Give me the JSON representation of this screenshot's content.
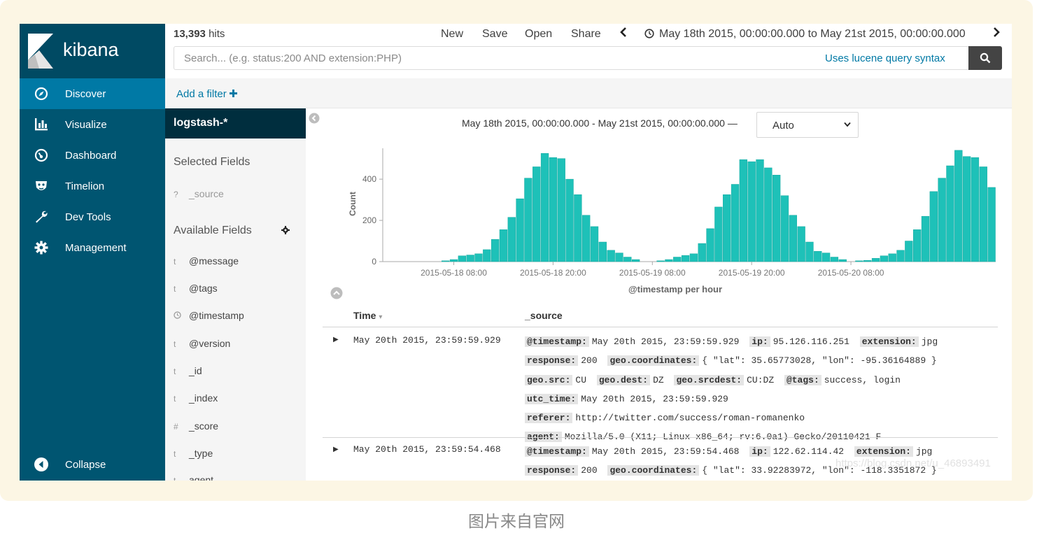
{
  "app": {
    "brand": "kibana"
  },
  "colors": {
    "nav_bg": "#005571",
    "nav_active": "#0079a5",
    "accent": "#0079a5",
    "bars": "#1ec1b8",
    "index_bg": "#002e3e"
  },
  "nav": {
    "items": [
      {
        "label": "Discover",
        "icon": "compass-icon",
        "active": true
      },
      {
        "label": "Visualize",
        "icon": "bar-chart-icon"
      },
      {
        "label": "Dashboard",
        "icon": "dashboard-gauge-icon"
      },
      {
        "label": "Timelion",
        "icon": "timelion-mask-icon"
      },
      {
        "label": "Dev Tools",
        "icon": "wrench-icon"
      },
      {
        "label": "Management",
        "icon": "gear-icon"
      }
    ],
    "collapse": "Collapse"
  },
  "header": {
    "hits_count": "13,393",
    "hits_label": "hits",
    "menu": {
      "new": "New",
      "save": "Save",
      "open": "Open",
      "share": "Share"
    },
    "time_range": "May 18th 2015, 00:00:00.000 to May 21st 2015, 00:00:00.000"
  },
  "search": {
    "placeholder": "Search... (e.g. status:200 AND extension:PHP)",
    "lucene_link": "Uses lucene query syntax"
  },
  "filter": {
    "add_label": "Add a filter"
  },
  "sidebar": {
    "index_pattern": "logstash-*",
    "selected_heading": "Selected Fields",
    "selected_fields": [
      {
        "type": "?",
        "name": "_source"
      }
    ],
    "available_heading": "Available Fields",
    "available_fields": [
      {
        "type": "t",
        "name": "@message"
      },
      {
        "type": "t",
        "name": "@tags"
      },
      {
        "type": "clock",
        "name": "@timestamp"
      },
      {
        "type": "t",
        "name": "@version"
      },
      {
        "type": "t",
        "name": "_id"
      },
      {
        "type": "t",
        "name": "_index"
      },
      {
        "type": "#",
        "name": "_score"
      },
      {
        "type": "t",
        "name": "_type"
      },
      {
        "type": "t",
        "name": "agent"
      }
    ]
  },
  "histogram": {
    "range_text": "May 18th 2015, 00:00:00.000 - May 21st 2015, 00:00:00.000 —",
    "interval": "Auto"
  },
  "chart_data": {
    "type": "bar",
    "ylabel": "Count",
    "xlabel": "@timestamp per hour",
    "ylim": [
      0,
      560
    ],
    "yticks": [
      0,
      200,
      400
    ],
    "x_tick_labels": [
      "2015-05-18 08:00",
      "2015-05-18 20:00",
      "2015-05-19 08:00",
      "2015-05-19 20:00",
      "2015-05-20 08:00"
    ],
    "x_tick_hours": [
      8,
      20,
      32,
      44,
      56
    ],
    "bucket": "1 hour",
    "x_hours": [
      0,
      1,
      2,
      3,
      4,
      5,
      6,
      7,
      8,
      9,
      10,
      11,
      12,
      13,
      14,
      15,
      16,
      17,
      18,
      19,
      20,
      21,
      22,
      23,
      24,
      25,
      26,
      27,
      28,
      29,
      30,
      31,
      32,
      33,
      34,
      35,
      36,
      37,
      38,
      39,
      40,
      41,
      42,
      43,
      44,
      45,
      46,
      47,
      48,
      49,
      50,
      51,
      52,
      53,
      54,
      55,
      56,
      57,
      58,
      59,
      60,
      61,
      62,
      63,
      64,
      65,
      66,
      67,
      68,
      69,
      70,
      71
    ],
    "values": [
      0,
      0,
      0,
      0,
      0,
      0,
      0,
      4,
      10,
      28,
      32,
      38,
      58,
      108,
      155,
      215,
      305,
      405,
      460,
      525,
      505,
      500,
      400,
      325,
      225,
      170,
      95,
      55,
      42,
      22,
      10,
      0,
      0,
      4,
      10,
      22,
      30,
      38,
      88,
      160,
      265,
      325,
      375,
      495,
      485,
      495,
      455,
      420,
      320,
      225,
      170,
      95,
      50,
      42,
      22,
      10,
      0,
      4,
      6,
      16,
      28,
      38,
      55,
      100,
      155,
      220,
      340,
      405,
      465,
      540,
      510,
      505,
      460,
      360
    ]
  },
  "table": {
    "columns": {
      "time": "Time",
      "source": "_source"
    },
    "rows": [
      {
        "time": "May 20th 2015, 23:59:59.929",
        "fields": [
          {
            "k": "@timestamp:",
            "v": "May 20th 2015, 23:59:59.929"
          },
          {
            "k": "ip:",
            "v": "95.126.116.251"
          },
          {
            "k": "extension:",
            "v": "jpg"
          },
          {
            "k": "response:",
            "v": "200"
          },
          {
            "k": "geo.coordinates:",
            "v": "{ \"lat\": 35.65773028, \"lon\": -95.36164889 }"
          },
          {
            "k": "geo.src:",
            "v": "CU"
          },
          {
            "k": "geo.dest:",
            "v": "DZ"
          },
          {
            "k": "geo.srcdest:",
            "v": "CU:DZ"
          },
          {
            "k": "@tags:",
            "v": "success, login"
          },
          {
            "k": "utc_time:",
            "v": "May 20th 2015, 23:59:59.929"
          },
          {
            "k": "referer:",
            "v": "http://twitter.com/success/roman-romanenko"
          },
          {
            "k": "agent:",
            "v": "Mozilla/5.0 (X11; Linux x86_64; rv:6.0a1) Gecko/20110421 F"
          }
        ]
      },
      {
        "time": "May 20th 2015, 23:59:54.468",
        "fields": [
          {
            "k": "@timestamp:",
            "v": "May 20th 2015, 23:59:54.468"
          },
          {
            "k": "ip:",
            "v": "122.62.114.42"
          },
          {
            "k": "extension:",
            "v": "jpg"
          },
          {
            "k": "response:",
            "v": "200"
          },
          {
            "k": "geo.coordinates:",
            "v": "{ \"lat\": 33.92283972, \"lon\": -118.3351872 }"
          }
        ]
      }
    ]
  },
  "watermark": "https://blog.csdn.net/u_46893491",
  "caption": "图片来自官网"
}
